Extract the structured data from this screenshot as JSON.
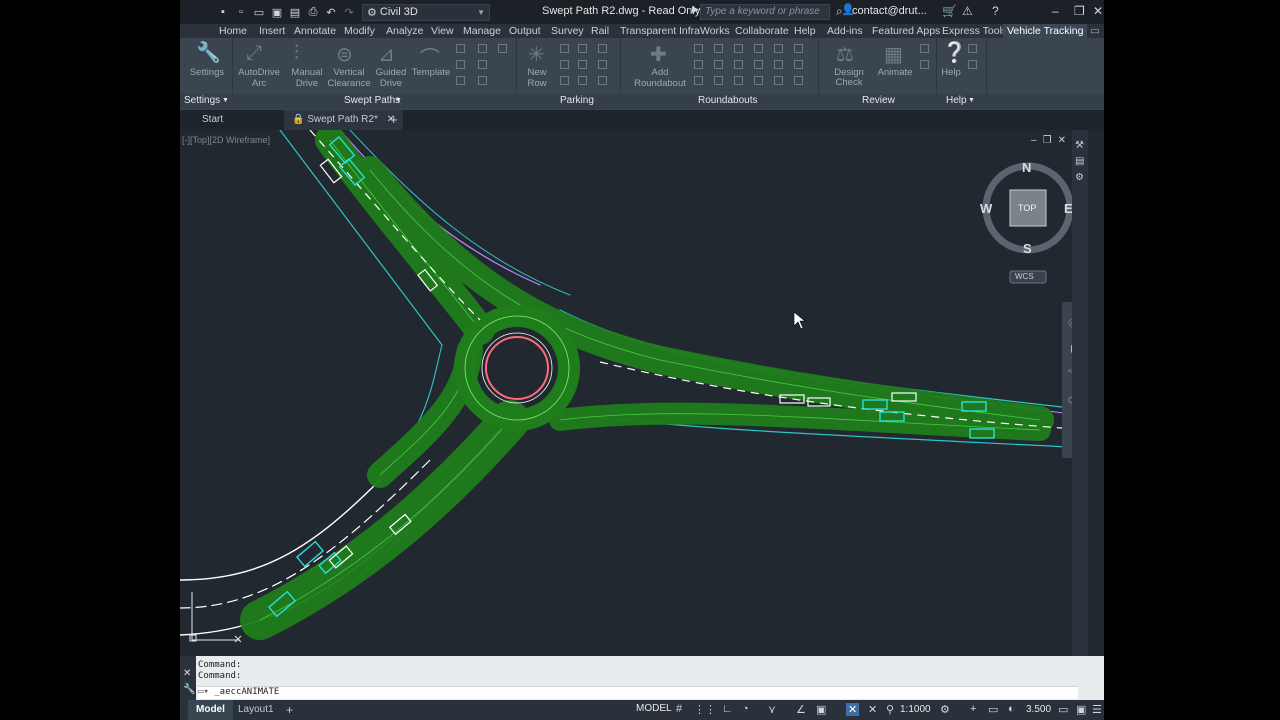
{
  "titlebar": {
    "workspace": "Civil 3D",
    "document_title": "Swept Path R2.dwg - Read Only",
    "search_placeholder": "Type a keyword or phrase",
    "user": "contact@drut..."
  },
  "ribbon_tabs": [
    {
      "label": "Home"
    },
    {
      "label": "Insert"
    },
    {
      "label": "Annotate"
    },
    {
      "label": "Modify"
    },
    {
      "label": "Analyze"
    },
    {
      "label": "View"
    },
    {
      "label": "Manage"
    },
    {
      "label": "Output"
    },
    {
      "label": "Survey"
    },
    {
      "label": "Rail"
    },
    {
      "label": "Transparent"
    },
    {
      "label": "InfraWorks"
    },
    {
      "label": "Collaborate"
    },
    {
      "label": "Help"
    },
    {
      "label": "Add-ins"
    },
    {
      "label": "Featured Apps"
    },
    {
      "label": "Express Tools"
    },
    {
      "label": "Vehicle Tracking"
    }
  ],
  "ribbon": {
    "settings": "Settings",
    "autodrive_arc_1": "AutoDrive",
    "autodrive_arc_2": "Arc",
    "manual_drive_1": "Manual",
    "manual_drive_2": "Drive",
    "vertical_clearance_1": "Vertical",
    "vertical_clearance_2": "Clearance",
    "guided_drive_1": "Guided",
    "guided_drive_2": "Drive",
    "template": "Template",
    "new_row_1": "New",
    "new_row_2": "Row",
    "add_roundabout_1": "Add",
    "add_roundabout_2": "Roundabout",
    "design_check": "Design Check",
    "animate": "Animate",
    "help": "Help"
  },
  "panels": {
    "settings": "Settings",
    "swept_paths": "Swept Paths",
    "parking": "Parking",
    "roundabouts": "Roundabouts",
    "review": "Review",
    "help": "Help"
  },
  "doc_tabs": {
    "start": "Start",
    "active": "Swept Path R2*"
  },
  "viewport": {
    "label": "[-][Top][2D Wireframe]",
    "compass": {
      "north": "N",
      "south": "S",
      "east": "E",
      "west": "W",
      "cube": "TOP",
      "wcs": "WCS"
    }
  },
  "command": {
    "history": [
      "Command:",
      "Command:"
    ],
    "input": "_aeccANIMATE"
  },
  "status": {
    "model_tab": "Model",
    "layout_tab": "Layout1",
    "model_button": "MODEL",
    "scale": "1:1000",
    "decimal": "3.500"
  },
  "colors": {
    "background": "#212830",
    "swept_path": "#1f7d1b",
    "vehicle": "#27e0d8",
    "island": "#ff6b7a",
    "edge_cyan": "#2ec4c4",
    "edge_violet": "#b98cff"
  }
}
